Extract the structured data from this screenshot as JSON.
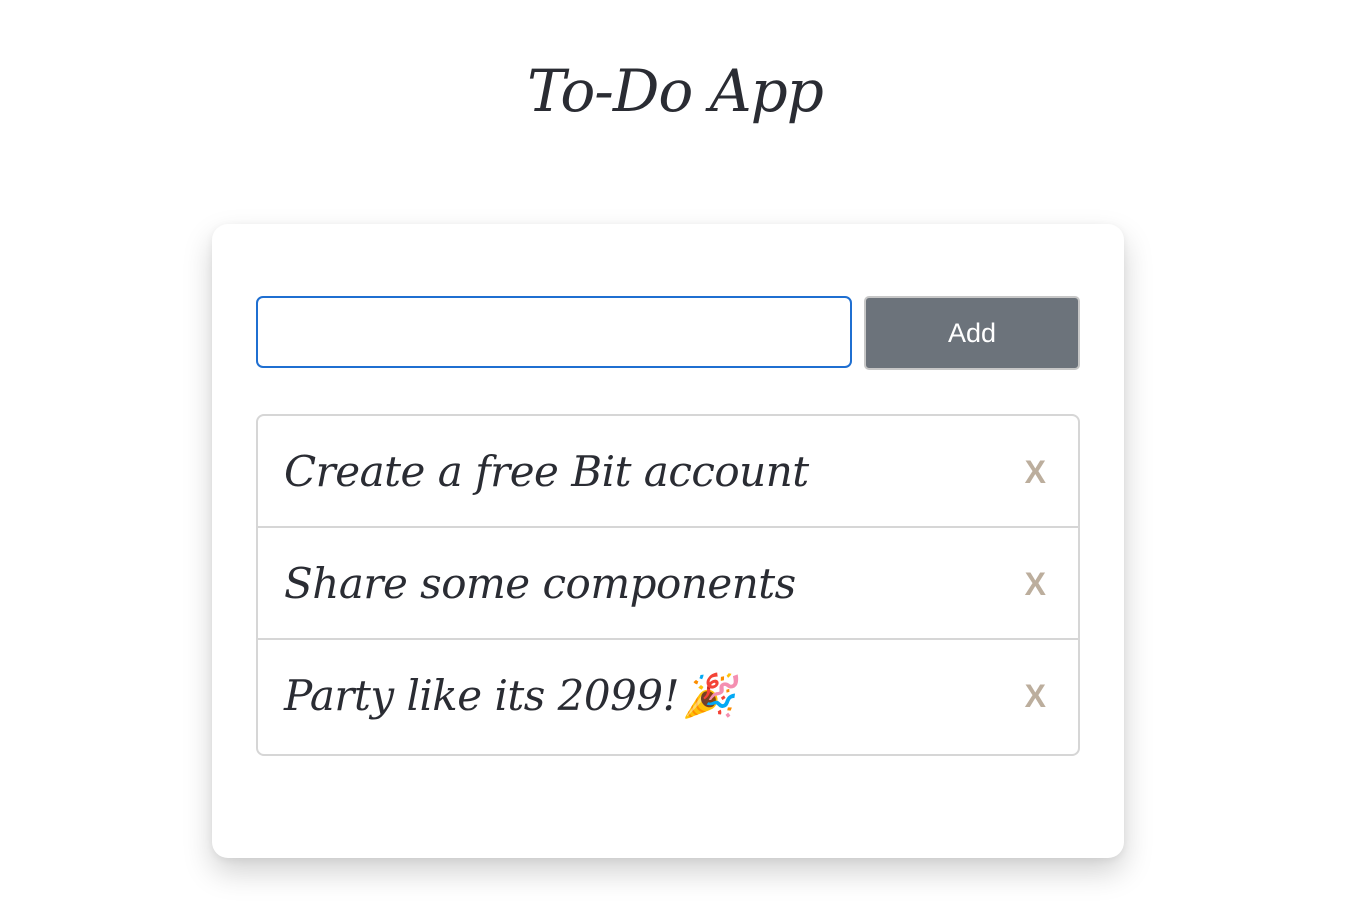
{
  "app": {
    "title": "To-Do App"
  },
  "form": {
    "input_value": "",
    "input_placeholder": "",
    "add_label": "Add"
  },
  "tasks": [
    {
      "text": "Create a free Bit account",
      "delete_label": "X"
    },
    {
      "text": "Share some components",
      "delete_label": "X"
    },
    {
      "text": "Party like its 2099!",
      "emoji": "🎉",
      "delete_label": "X"
    }
  ],
  "colors": {
    "input_focus_border": "#1f6fd1",
    "button_bg": "#6c737b",
    "delete_x": "#bcae9d",
    "text": "#2a2c33"
  }
}
